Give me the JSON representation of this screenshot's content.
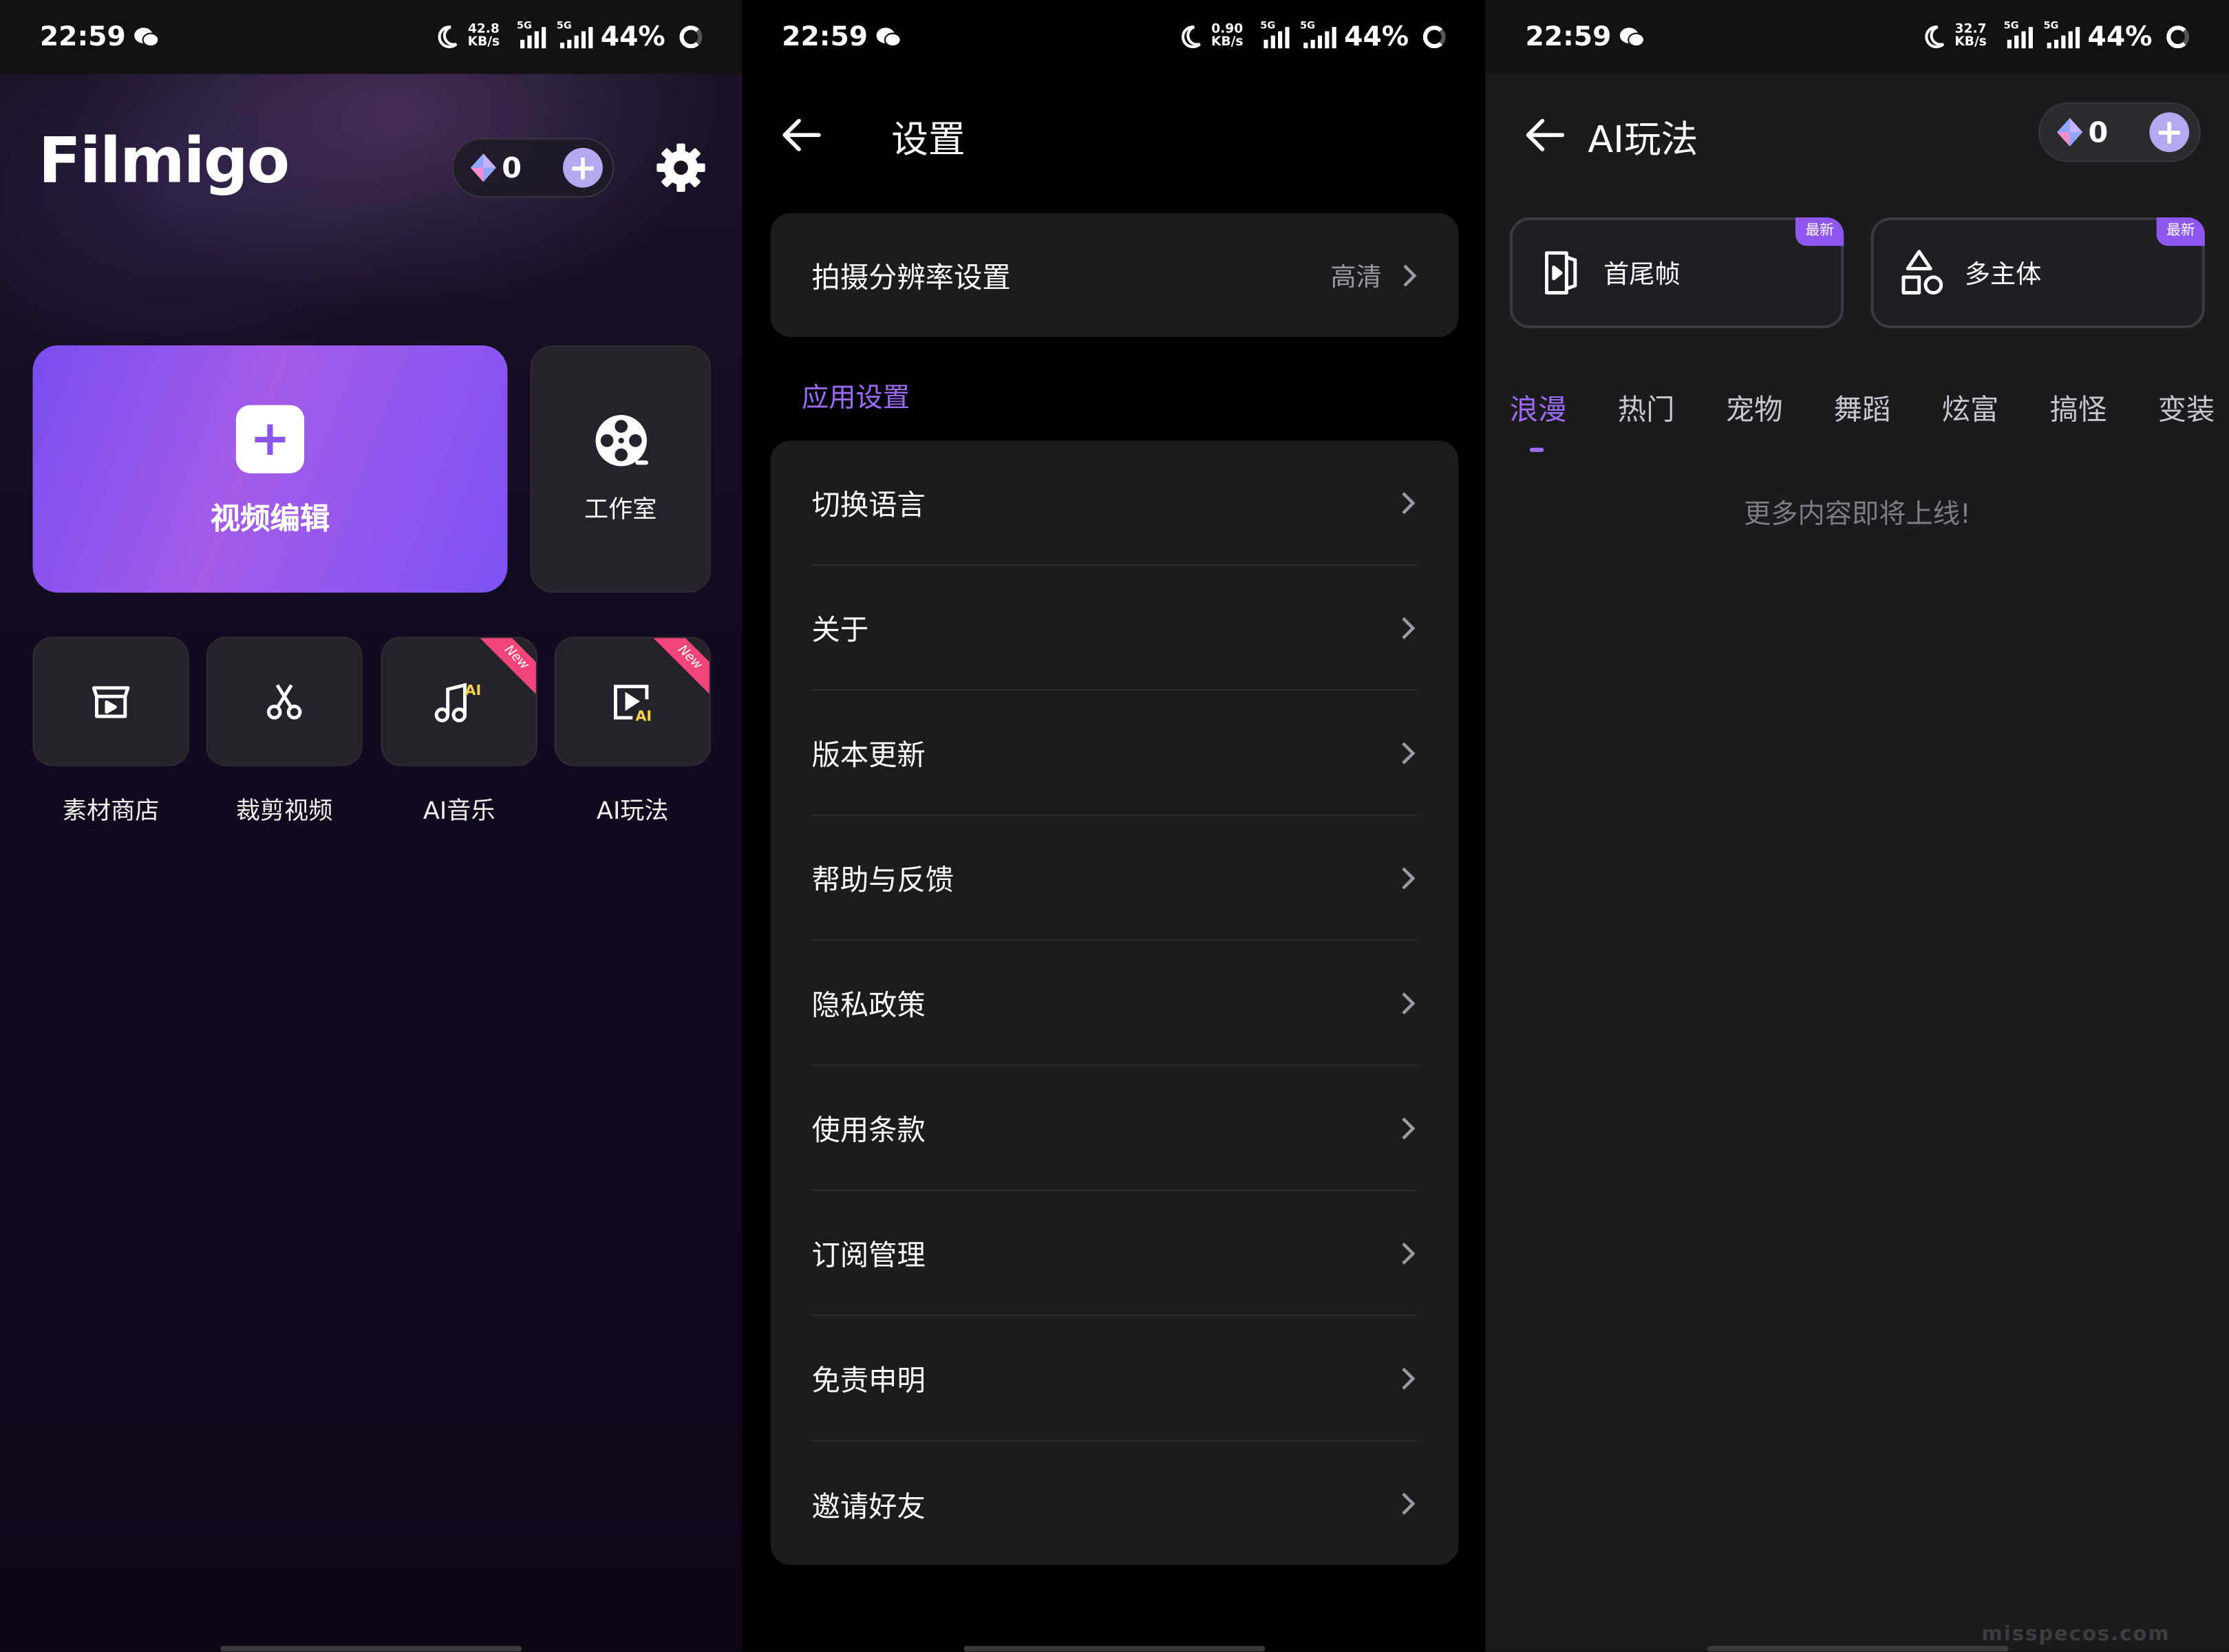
{
  "statusbar": [
    {
      "time": "22:59",
      "speed_top": "42.8",
      "speed_unit": "KB/s",
      "net": "5G",
      "battery": "44%"
    },
    {
      "time": "22:59",
      "speed_top": "0.90",
      "speed_unit": "KB/s",
      "net": "5G",
      "battery": "44%"
    },
    {
      "time": "22:59",
      "speed_top": "32.7",
      "speed_unit": "KB/s",
      "net": "5G",
      "battery": "44%"
    }
  ],
  "home": {
    "logo": "Filmigo",
    "credits": "0",
    "edit_label": "视频编辑",
    "studio_label": "工作室",
    "tools": [
      {
        "label": "素材商店"
      },
      {
        "label": "裁剪视频"
      },
      {
        "label": "AI音乐",
        "badge": "New"
      },
      {
        "label": "AI玩法",
        "badge": "New"
      }
    ]
  },
  "settings": {
    "title": "设置",
    "resolution_label": "拍摄分辨率设置",
    "resolution_value": "高清",
    "section": "应用设置",
    "items": [
      "切换语言",
      "关于",
      "版本更新",
      "帮助与反馈",
      "隐私政策",
      "使用条款",
      "订阅管理",
      "免责申明",
      "邀请好友"
    ]
  },
  "ai": {
    "title": "AI玩法",
    "credits": "0",
    "features": [
      {
        "label": "首尾帧",
        "badge": "最新"
      },
      {
        "label": "多主体",
        "badge": "最新"
      }
    ],
    "tabs": [
      "浪漫",
      "热门",
      "宠物",
      "舞蹈",
      "炫富",
      "搞怪",
      "变装"
    ],
    "empty_message": "更多内容即将上线!"
  },
  "watermark": "misspecos.com",
  "colors": {
    "accent": "#9d6cf6",
    "ribbon": "#f2457a",
    "card_gradient_start": "#7a4ef0"
  }
}
